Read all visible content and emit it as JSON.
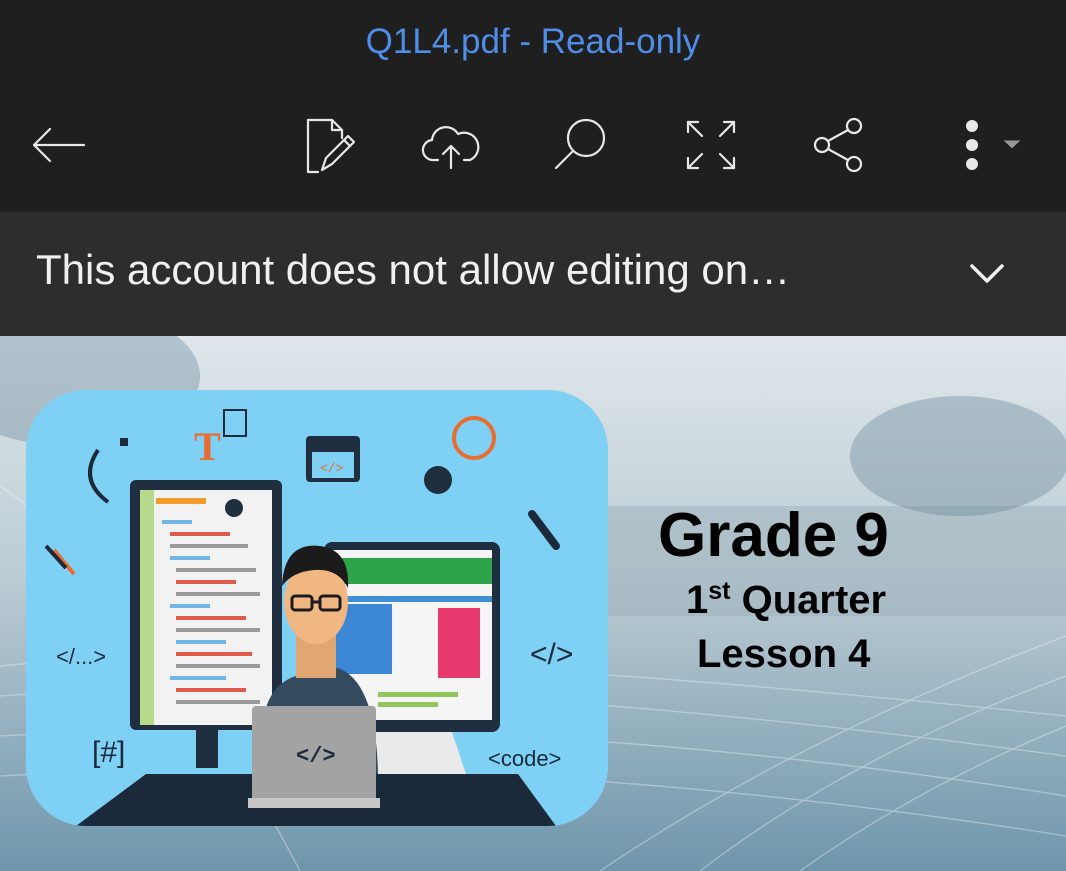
{
  "header": {
    "title": "Q1L4.pdf - Read-only",
    "title_color": "#4f8ee8",
    "icons": [
      "back-arrow-icon",
      "edit-document-icon",
      "cloud-upload-icon",
      "search-icon",
      "fullscreen-icon",
      "share-icon",
      "more-options-icon",
      "dropdown-triangle-icon"
    ]
  },
  "banner": {
    "message": "This account does not allow editing on…",
    "expand_icon": "chevron-down-icon"
  },
  "document": {
    "grade": "Grade 9",
    "quarter_number": "1",
    "quarter_suffix": "st",
    "quarter_label": "Quarter",
    "lesson": "Lesson 4",
    "illustration": {
      "labels": [
        "T",
        "</>",
        "</...>",
        "</>",
        "[#]",
        "<code>",
        "</>"
      ]
    }
  }
}
